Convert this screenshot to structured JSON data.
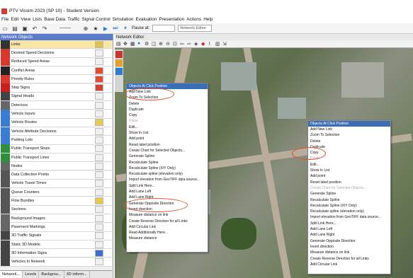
{
  "window_title": "PTV Vissim 2023 (SP 10) - Student Version",
  "menu": [
    "File",
    "Edit",
    "View",
    "Lists",
    "Base Data",
    "Traffic",
    "Signal Control",
    "Simulation",
    "Evaluation",
    "Presentation",
    "Actions",
    "Help"
  ],
  "toolbar": {
    "pause_label": "Pause at:",
    "view_select": "Network Editor"
  },
  "network_objects": {
    "title": "Network Objects",
    "items": [
      {
        "label": "Links",
        "swatch": "#e0c14a",
        "icon_color": "#333",
        "selected": true
      },
      {
        "label": "Desired Speed Decisions",
        "swatch": "#f0f0f0",
        "icon_color": "#d9382d"
      },
      {
        "label": "Reduced Speed Areas",
        "swatch": "#f0f0f0",
        "icon_color": "#d9382d"
      },
      {
        "label": "Conflict Areas",
        "swatch": "#e64a2e",
        "icon_color": "#222"
      },
      {
        "label": "Priority Rules",
        "swatch": "#e64a2e",
        "icon_color": "#d9382d"
      },
      {
        "label": "Stop Signs",
        "swatch": "#d94030",
        "icon_color": "#c91f1f"
      },
      {
        "label": "Signal Heads",
        "swatch": "#f0f0f0",
        "icon_color": "#444"
      },
      {
        "label": "Detectors",
        "swatch": "#f0f0f0",
        "icon_color": "#666"
      },
      {
        "label": "Vehicle Inputs",
        "swatch": "#f0f0f0",
        "icon_color": "#3a7bd5"
      },
      {
        "label": "Vehicle Routes",
        "swatch": "#e9c94a",
        "icon_color": "#3a7bd5"
      },
      {
        "label": "Vehicle Attribute Decisions",
        "swatch": "#f0f0f0",
        "icon_color": "#3a7bd5"
      },
      {
        "label": "Parking Lots",
        "swatch": "#f0f0f0",
        "icon_color": "#3a7bd5"
      },
      {
        "label": "Public Transport Stops",
        "swatch": "#f0f0f0",
        "icon_color": "#2f8f3a"
      },
      {
        "label": "Public Transport Lines",
        "swatch": "#f0f0f0",
        "icon_color": "#2f8f3a"
      },
      {
        "label": "Nodes",
        "swatch": "#f0f0f0",
        "icon_color": "#666"
      },
      {
        "label": "Data Collection Points",
        "swatch": "#f0f0f0",
        "icon_color": "#555"
      },
      {
        "label": "Vehicle Travel Times",
        "swatch": "#f0f0f0",
        "icon_color": "#555"
      },
      {
        "label": "Queue Counters",
        "swatch": "#f0f0f0",
        "icon_color": "#555"
      },
      {
        "label": "Flow Bundles",
        "swatch": "#e9c94a",
        "icon_color": "#555"
      },
      {
        "label": "Sections",
        "swatch": "#f0f0f0",
        "icon_color": "#555"
      },
      {
        "label": "Background Images",
        "swatch": "#f0f0f0",
        "icon_color": "#666"
      },
      {
        "label": "Pavement Markings",
        "swatch": "#f0f0f0",
        "icon_color": "#666"
      },
      {
        "label": "3D Traffic Signals",
        "swatch": "#f0f0f0",
        "icon_color": "#444"
      },
      {
        "label": "Static 3D Models",
        "swatch": "#f0f0f0",
        "icon_color": "#444"
      },
      {
        "label": "3D Information Signs",
        "swatch": "#3a6fd0",
        "icon_color": "#444"
      },
      {
        "label": "Vehicles In Network",
        "swatch": "#f0f0f0",
        "icon_color": "#444"
      }
    ],
    "tabs": [
      "Network...",
      "Levels",
      "Backgrou...",
      "3D inform..."
    ]
  },
  "network_editor": {
    "title": "Network Editor"
  },
  "context_menu_1": {
    "header": "Objects At Click Position",
    "items": [
      {
        "label": "Add New Link"
      },
      {
        "label": "Zoom To Selection"
      },
      {
        "label": "Delete"
      },
      {
        "label": "Duplicate"
      },
      {
        "label": "Copy"
      },
      {
        "label": "Paste",
        "disabled": true
      },
      {
        "label": "Edit..."
      },
      {
        "label": "Show In List"
      },
      {
        "label": "Add point"
      },
      {
        "label": "Reset label position"
      },
      {
        "label": "Create Chart for Selected Objects..."
      },
      {
        "label": "Generate Spline"
      },
      {
        "label": "Recalculate Spline"
      },
      {
        "label": "Recalculate Spline (X/Y Only)"
      },
      {
        "label": "Recalculate spline (elevation only)"
      },
      {
        "label": "Import elevation from GeoTIFF data source..."
      },
      {
        "label": "Split Link Here..."
      },
      {
        "label": "Add Lane Left"
      },
      {
        "label": "Add Lane Right"
      },
      {
        "label": "Generate Opposite Direction"
      },
      {
        "label": "Invert direction"
      },
      {
        "label": "Measure distance on link"
      },
      {
        "label": "Create Reverse Direction for all Links"
      },
      {
        "label": "Add Circular Link"
      },
      {
        "label": "Read Additionally Here..."
      },
      {
        "label": "Measure distance"
      }
    ]
  },
  "context_menu_2": {
    "header": "Objects At Click Position",
    "items": [
      {
        "label": "Add New Link"
      },
      {
        "label": "Zoom To Selection"
      },
      {
        "label": "Delete"
      },
      {
        "label": "Duplicate"
      },
      {
        "label": "Copy"
      },
      {
        "label": "Paste",
        "disabled": true
      },
      {
        "label": "Edit..."
      },
      {
        "label": "Show In List"
      },
      {
        "label": "Add point"
      },
      {
        "label": "Reset label position"
      },
      {
        "label": "Create Chart for Selected Objects...",
        "disabled": true
      },
      {
        "label": "Generate Spline"
      },
      {
        "label": "Recalculate Spline"
      },
      {
        "label": "Recalculate Spline (X/Y Only)"
      },
      {
        "label": "Recalculate spline (elevation only)"
      },
      {
        "label": "Import elevation from GeoTIFF data source..."
      },
      {
        "label": "Split Link Here..."
      },
      {
        "label": "Add Lane Left"
      },
      {
        "label": "Add Lane Right"
      },
      {
        "label": "Generate Opposite Direction"
      },
      {
        "label": "Invert direction"
      },
      {
        "label": "Measure distance on link"
      },
      {
        "label": "Create Reverse Direction for all Links"
      },
      {
        "label": "Add Circular Link"
      }
    ]
  },
  "colors": {
    "accent": "#3a6fb8",
    "highlight_circle": "#e0522f",
    "selected_row": "#f8e6a4"
  }
}
